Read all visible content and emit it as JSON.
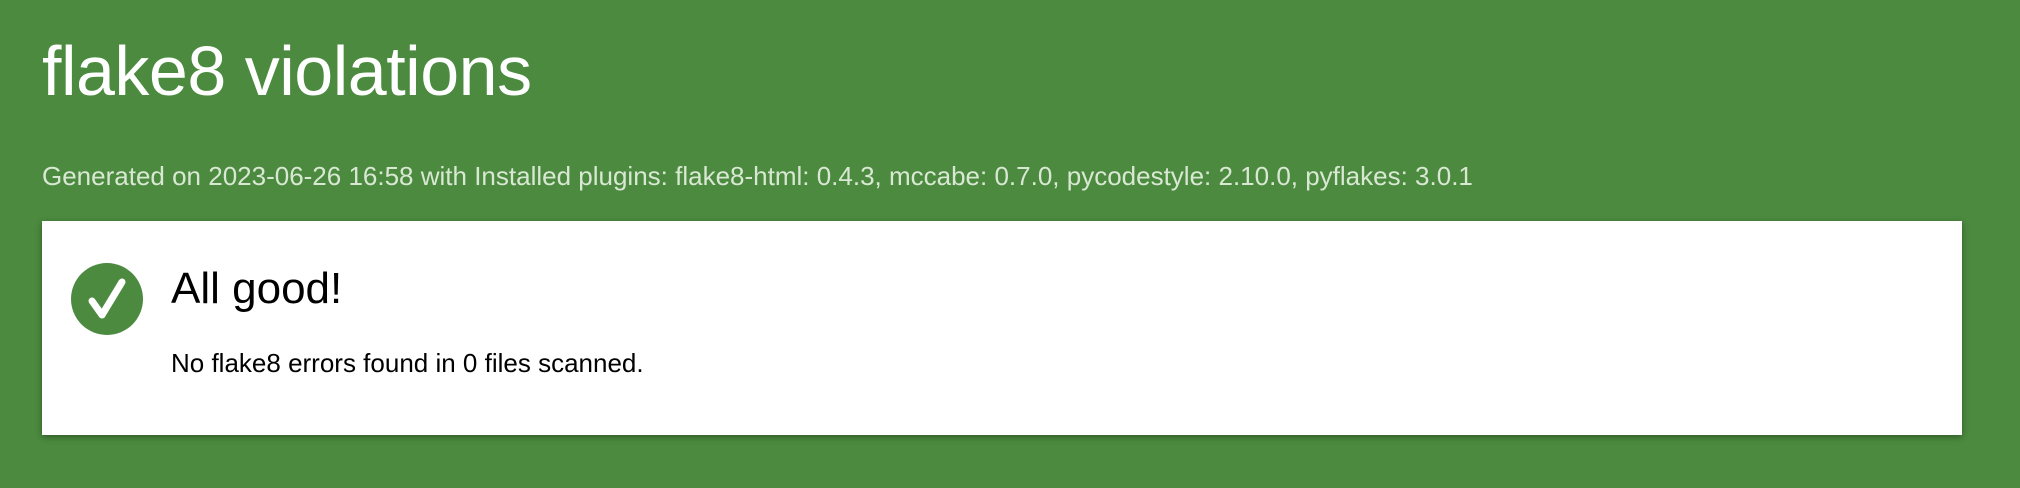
{
  "header": {
    "title": "flake8 violations",
    "subtitle": "Generated on 2023-06-26 16:58 with Installed plugins: flake8-html: 0.4.3, mccabe: 0.7.0, pycodestyle: 2.10.0, pyflakes: 3.0.1"
  },
  "summary": {
    "icon": "checkmark-icon",
    "heading": "All good!",
    "message": "No flake8 errors found in 0 files scanned."
  },
  "colors": {
    "background": "#4b8a3f",
    "card": "#ffffff",
    "check_circle": "#4b8a3f",
    "subtitle_text": "#d9e8d3"
  }
}
